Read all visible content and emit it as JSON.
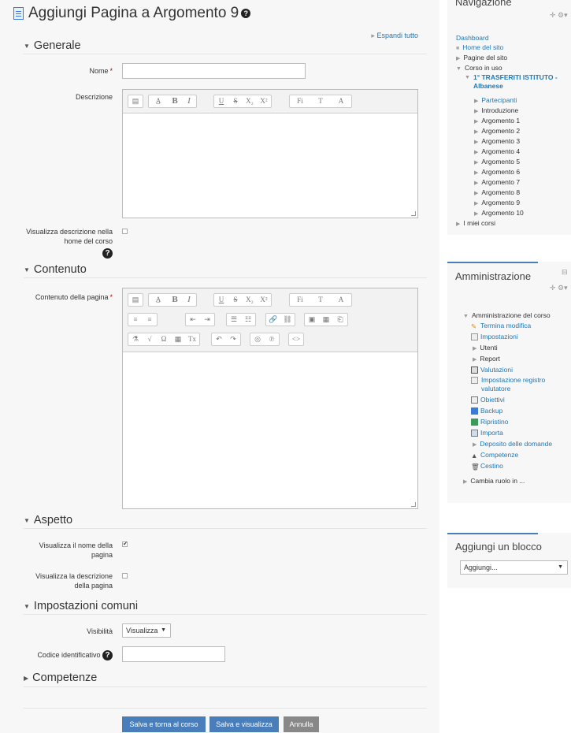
{
  "page": {
    "title": "Aggiungi Pagina a Argomento 9",
    "expand_all": "Espandi tutto"
  },
  "sections": {
    "generale": "Generale",
    "contenuto": "Contenuto",
    "aspetto": "Aspetto",
    "impostazioni": "Impostazioni comuni",
    "competenze": "Competenze"
  },
  "form": {
    "nome_label": "Nome",
    "nome_value": "",
    "descrizione_label": "Descrizione",
    "visualizza_descr_label": "Visualizza descrizione nella home del corso",
    "contenuto_label": "Contenuto della pagina",
    "visualizza_nome_label": "Visualizza il nome della pagina",
    "visualizza_nome_checked": true,
    "visualizza_descr_pagina_label": "Visualizza la descrizione della pagina",
    "visibilita_label": "Visibilità",
    "visibilita_value": "Visualizza",
    "codice_label": "Codice identificativo",
    "codice_value": "",
    "required_mark": "*"
  },
  "toolbar": {
    "row1": [
      "▤",
      "A̲",
      "B",
      "I",
      "U",
      "S",
      "X₂",
      "X²",
      "Fi",
      "T",
      "A"
    ],
    "row2": [
      "≡",
      "≡",
      "⇤",
      "⇥",
      "☰",
      "☷",
      "🔗",
      "⛓",
      "▣",
      "▦",
      "⎗"
    ],
    "row3": [
      "⚗",
      "√",
      "Ω",
      "▦",
      "Tx",
      "↶",
      "↷",
      "◎",
      "℗",
      "<>"
    ]
  },
  "buttons": {
    "save_return": "Salva e torna al corso",
    "save_view": "Salva e visualizza",
    "cancel": "Annulla"
  },
  "navigation": {
    "title": "Navigazione",
    "dashboard": "Dashboard",
    "home": "Home del sito",
    "site_pages": "Pagine del sito",
    "current_course": "Corso in uso",
    "course_name": "1° TRASFERITI ISTITUTO - Albanese",
    "participants": "Partecipanti",
    "intro": "Introduzione",
    "topics": [
      "Argomento 1",
      "Argomento 2",
      "Argomento 3",
      "Argomento 4",
      "Argomento 5",
      "Argomento 6",
      "Argomento 7",
      "Argomento 8",
      "Argomento 9",
      "Argomento 10"
    ],
    "my_courses": "I miei corsi"
  },
  "admin": {
    "title": "Amministrazione",
    "course_admin": "Amministrazione del corso",
    "items": [
      "Termina modifica",
      "Impostazioni",
      "Utenti",
      "Report",
      "Valutazioni",
      "Impostazione registro valutatore",
      "Obiettivi",
      "Backup",
      "Ripristino",
      "Importa",
      "Deposito delle domande",
      "Competenze",
      "Cestino"
    ],
    "switch_role": "Cambia ruolo in ..."
  },
  "add_block": {
    "title": "Aggiungi un blocco",
    "select_value": "Aggiungi..."
  },
  "colors": {
    "link": "#1f77b4",
    "button_primary": "#4a7ebb",
    "button_cancel": "#888888",
    "required": "#cc0000"
  }
}
